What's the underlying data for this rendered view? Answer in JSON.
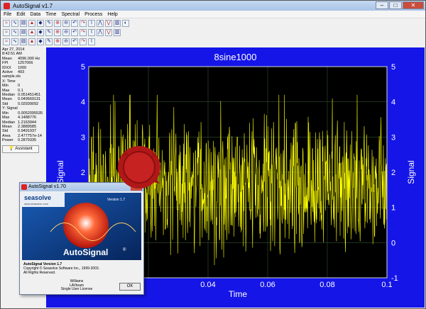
{
  "window": {
    "title": "AutoSignal v1.7"
  },
  "menu": [
    "File",
    "Edit",
    "Data",
    "Time",
    "Spectral",
    "Process",
    "Help"
  ],
  "toolbar_rows": [
    [
      "open-icon",
      "save-icon",
      "print-icon",
      "copy-icon",
      "paste-icon",
      "chart-icon",
      "filter-icon",
      "zoom-icon",
      "undo-icon",
      "redo-icon",
      "add-icon",
      "remove-icon",
      "cursor-icon",
      "settings-icon",
      "grid-icon"
    ],
    [
      "peak-icon",
      "wave-icon",
      "fft-icon",
      "sine-icon",
      "spectrum-icon",
      "smooth-icon",
      "fit-icon",
      "trend-icon",
      "hist-icon",
      "lag-icon",
      "corr-icon",
      "window-icon",
      "trans-icon",
      "deriv-icon"
    ],
    [
      "ar-icon",
      "arma-icon",
      "mem-icon",
      "music-icon",
      "esprit-icon",
      "wavelet-icon",
      "phase-icon",
      "coh-icon",
      "ampl-icon",
      "pwr-icon",
      "mag-icon"
    ]
  ],
  "info_panel": {
    "date": "Apr 27, 2014",
    "time": "8:42:51 AM",
    "rows": [
      {
        "k": "Mean",
        "v": "4096.000 Hz"
      },
      {
        "k": "FPI",
        "v": "1257066"
      },
      {
        "k": "IDXX",
        "v": "1000"
      },
      {
        "k": "Active",
        "v": "493"
      },
      {
        "k": "sample.xls",
        "v": ""
      }
    ],
    "x_header": "X: Time",
    "x_stats": [
      {
        "k": "Min",
        "v": "0"
      },
      {
        "k": "Max",
        "v": "0.1"
      },
      {
        "k": "Median",
        "v": "0.051451451"
      },
      {
        "k": "Mean",
        "v": "0.049569131"
      },
      {
        "k": "Std",
        "v": "0.02939092"
      }
    ],
    "y_header": "Y: Signal",
    "y_stats": [
      {
        "k": "Min",
        "v": "0.0052095535"
      },
      {
        "k": "Max",
        "v": "4.1488776"
      },
      {
        "k": "Median",
        "v": "1.2163944"
      },
      {
        "k": "Mean",
        "v": "2.3889585"
      },
      {
        "k": "Std",
        "v": "0.9491937"
      },
      {
        "k": "Area",
        "v": "2.477757e-14"
      },
      {
        "k": "Power",
        "v": "0.2879335"
      }
    ],
    "assistant_label": "Assistant"
  },
  "chart_data": {
    "type": "line",
    "title": "8sine1000",
    "xlabel": "Time",
    "ylabel": "Signal",
    "xlim": [
      0,
      0.1
    ],
    "ylim": [
      -1,
      5
    ],
    "x_ticks": [
      "0.04",
      "0.06",
      "0.08",
      "0.1"
    ],
    "y_ticks": [
      "5",
      "4",
      "3",
      "2",
      "1",
      "0",
      "-1"
    ],
    "grid": true,
    "series_color": "#ffff00",
    "background": "#000000",
    "panel_color": "#1515e8"
  },
  "dialog": {
    "title": "AutoSignal v1.70",
    "version_badge": "Version 1.7",
    "brand": "seasolve",
    "brand_url": "www.seasolve.com",
    "product": "AutoSignal",
    "registered": "®",
    "version_line": "AutoSignal Version 1.7",
    "copyright": "Copyright © Seasolve Software Inc., 1999-2003.",
    "rights": "All Rights Reserved.",
    "user_name": "Williams",
    "team": "LAVteam",
    "license": "Single User License",
    "ok_label": "OK"
  }
}
